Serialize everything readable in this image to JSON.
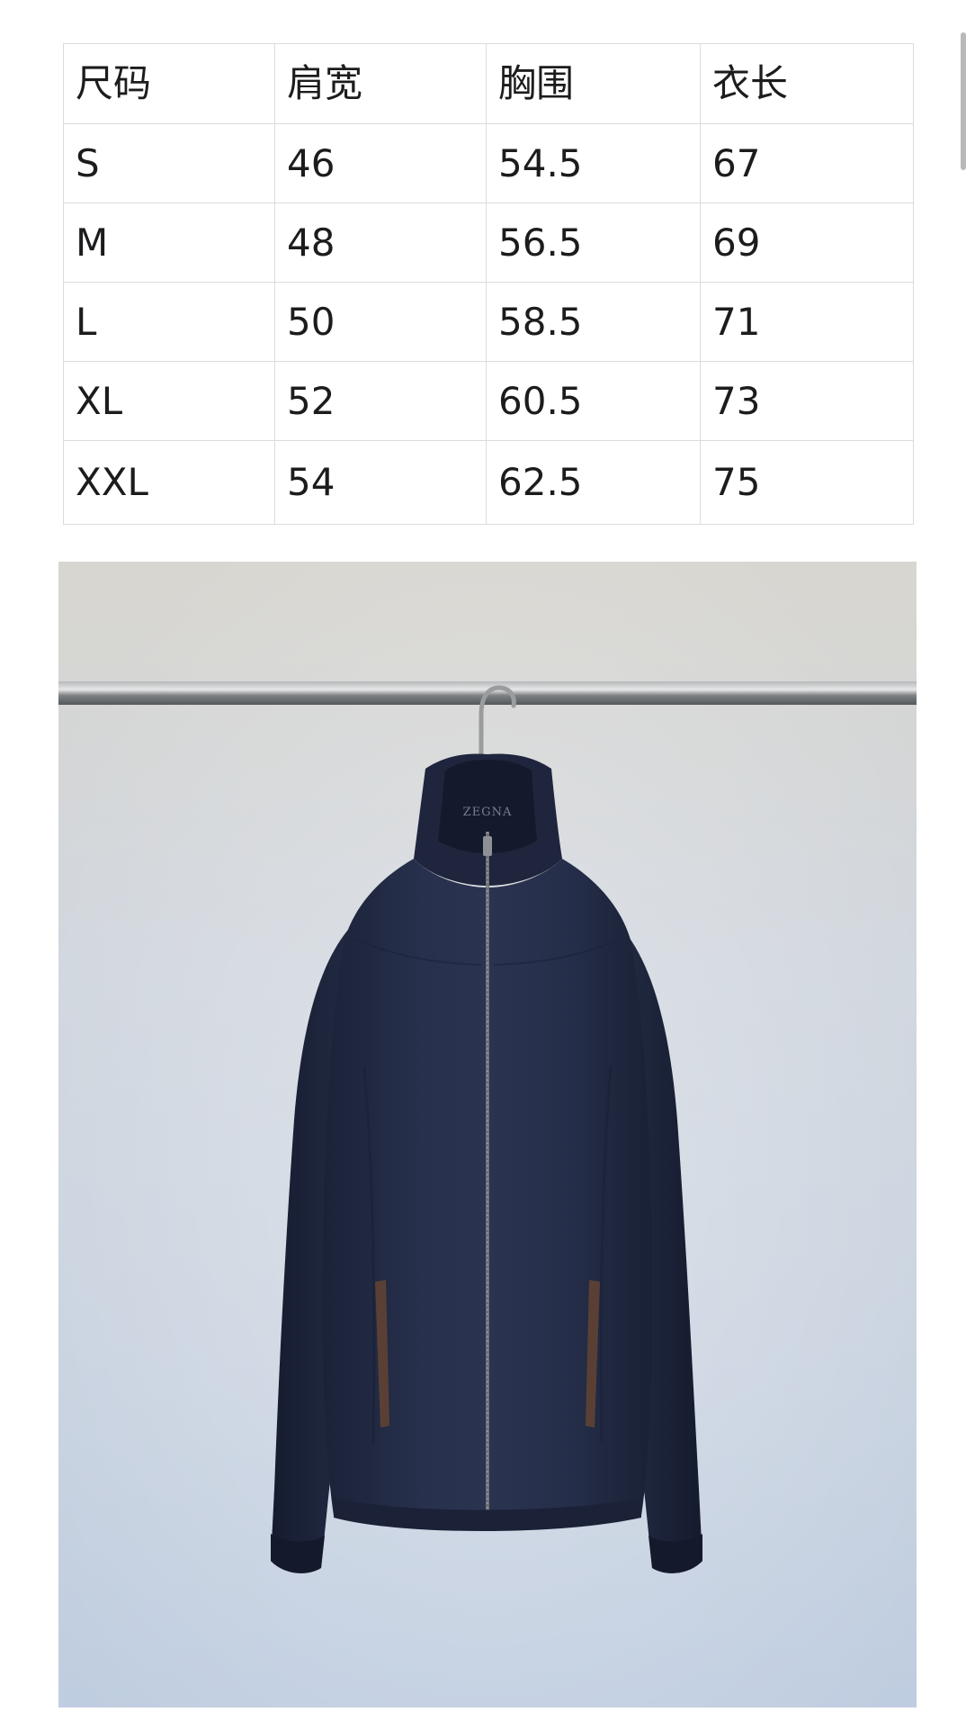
{
  "size_chart": {
    "headers": [
      "尺码",
      "肩宽",
      "胸围",
      "衣长"
    ],
    "rows": [
      [
        "S",
        "46",
        "54.5",
        "67"
      ],
      [
        "M",
        "48",
        "56.5",
        "69"
      ],
      [
        "L",
        "50",
        "58.5",
        "71"
      ],
      [
        "XL",
        "52",
        "60.5",
        "73"
      ],
      [
        "XXL",
        "54",
        "62.5",
        "75"
      ]
    ]
  },
  "product_photo": {
    "subject": "navy zip-up stand-collar jacket on hanger",
    "collar_label": "ZEGNA",
    "colors": {
      "jacket": "#232b45",
      "wall": "#c9d3df",
      "rail": "#8a8d90",
      "pocket_trim": "#5a4034"
    }
  },
  "scrollbar": {
    "visible": true
  }
}
